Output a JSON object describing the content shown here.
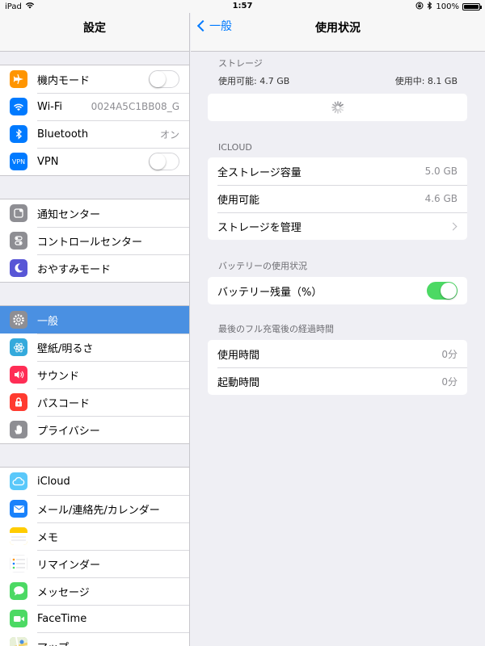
{
  "status": {
    "device": "iPad",
    "time": "1:57",
    "battery": "100%",
    "battery_level": 1.0
  },
  "sidebar": {
    "title": "設定",
    "groups": [
      [
        {
          "label": "機内モード",
          "icon": "airplane-icon",
          "color": "#ff9500",
          "control": "toggle",
          "on": false
        },
        {
          "label": "Wi-Fi",
          "icon": "wifi-icon",
          "color": "#007aff",
          "value": "0024A5C1BB08_G"
        },
        {
          "label": "Bluetooth",
          "icon": "bluetooth-icon",
          "color": "#007aff",
          "value": "オン"
        },
        {
          "label": "VPN",
          "icon": "vpn-icon",
          "icon_text": "VPN",
          "color": "#007aff",
          "control": "toggle",
          "on": false
        }
      ],
      [
        {
          "label": "通知センター",
          "icon": "notification-center-icon",
          "color": "#8e8e93"
        },
        {
          "label": "コントロールセンター",
          "icon": "control-center-icon",
          "color": "#8e8e93"
        },
        {
          "label": "おやすみモード",
          "icon": "moon-icon",
          "color": "#5856d6"
        }
      ],
      [
        {
          "label": "一般",
          "icon": "gear-icon",
          "color": "#8e8e93",
          "selected": true
        },
        {
          "label": "壁紙/明るさ",
          "icon": "wallpaper-icon",
          "color": "#34aadc"
        },
        {
          "label": "サウンド",
          "icon": "sound-icon",
          "color": "#ff2d55"
        },
        {
          "label": "パスコード",
          "icon": "lock-icon",
          "color": "#ff3b30"
        },
        {
          "label": "プライバシー",
          "icon": "hand-icon",
          "color": "#8e8e93"
        }
      ],
      [
        {
          "label": "iCloud",
          "icon": "icloud-icon",
          "color": "#5ac8fa"
        },
        {
          "label": "メール/連絡先/カレンダー",
          "icon": "mail-icon",
          "color": "#1a82fb"
        },
        {
          "label": "メモ",
          "icon": "notes-icon",
          "color": "#ffcc00"
        },
        {
          "label": "リマインダー",
          "icon": "reminders-icon",
          "color": "#ffffff"
        },
        {
          "label": "メッセージ",
          "icon": "messages-icon",
          "color": "#4cd964"
        },
        {
          "label": "FaceTime",
          "icon": "facetime-icon",
          "color": "#4cd964"
        },
        {
          "label": "マップ",
          "icon": "maps-icon",
          "color": "#8fd16a"
        }
      ]
    ]
  },
  "nav": {
    "back_label": "一般",
    "title": "使用状況"
  },
  "storage": {
    "header": "ストレージ",
    "available": "使用可能: 4.7 GB",
    "used": "使用中: 8.1 GB"
  },
  "icloud": {
    "header": "ICLOUD",
    "rows": [
      {
        "label": "全ストレージ容量",
        "value": "5.0 GB"
      },
      {
        "label": "使用可能",
        "value": "4.6 GB"
      },
      {
        "label": "ストレージを管理",
        "value": ""
      }
    ]
  },
  "battery_usage": {
    "header": "バッテリーの使用状況",
    "row_label": "バッテリー残量（%）",
    "on": true
  },
  "since_charge": {
    "header": "最後のフル充電後の経過時間",
    "rows": [
      {
        "label": "使用時間",
        "value": "0分"
      },
      {
        "label": "起動時間",
        "value": "0分"
      }
    ]
  },
  "colors": {
    "accent": "#007aff",
    "selected": "#4a90e2",
    "toggle_on": "#4cd964"
  }
}
